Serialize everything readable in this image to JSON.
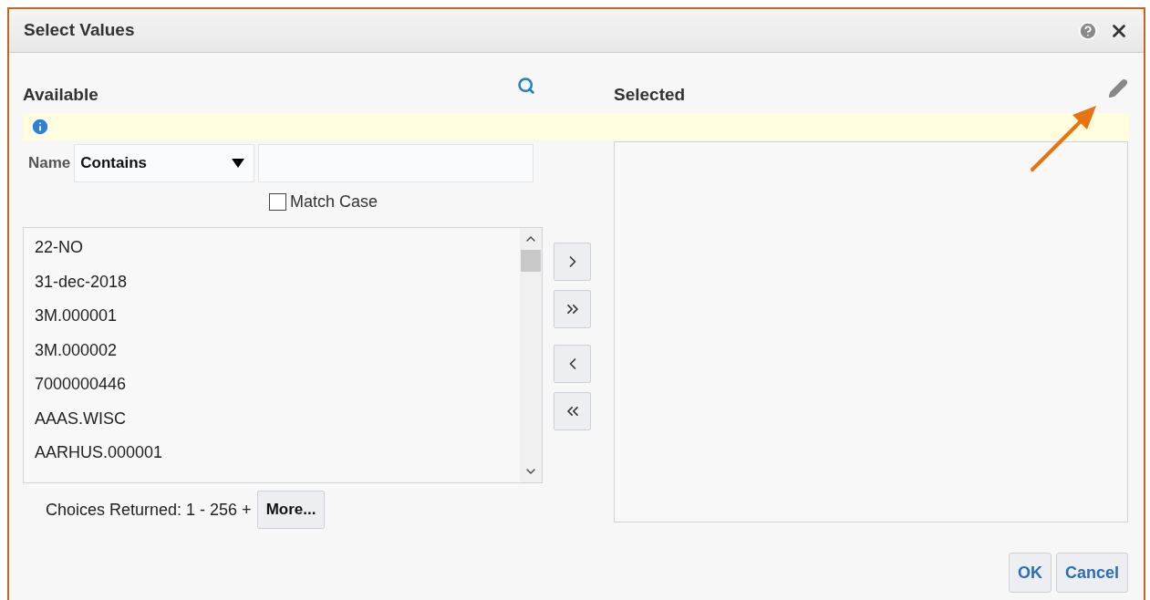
{
  "dialog": {
    "title": "Select Values"
  },
  "available": {
    "heading": "Available",
    "filter": {
      "label": "Name",
      "operator": "Contains"
    },
    "match_case": {
      "label": "Match Case",
      "checked": false
    },
    "items": [
      "22-NO",
      "31-dec-2018",
      "3M.000001",
      "3M.000002",
      "7000000446",
      "AAAS.WISC",
      "AARHUS.000001"
    ],
    "choices_returned": "Choices Returned: 1 - 256 +",
    "more_button": "More..."
  },
  "selected": {
    "heading": "Selected"
  },
  "footer_buttons": [
    "OK",
    "Cancel"
  ]
}
